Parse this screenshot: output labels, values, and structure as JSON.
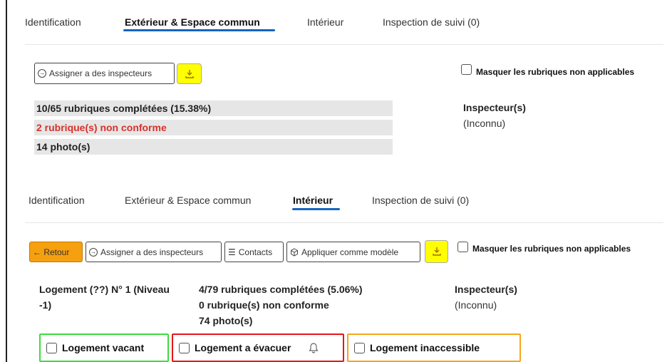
{
  "section1": {
    "tabs": [
      {
        "label": "Identification",
        "active": false
      },
      {
        "label": "Extérieur & Espace commun",
        "active": true
      },
      {
        "label": "Intérieur",
        "active": false
      },
      {
        "label": "Inspection de suivi (0)",
        "active": false
      }
    ],
    "assign_button": "Assigner a des inspecteurs",
    "download_icon": "download-icon",
    "hide_checkbox_label": "Masquer les rubriques non applicables",
    "stats": {
      "completed": "10/65 rubriques complétées (15.38%)",
      "non_conform": "2 rubrique(s) non conforme",
      "photos": "14 photo(s)"
    },
    "inspector_heading": "Inspecteur(s)",
    "inspector_value": "(Inconnu)"
  },
  "section2": {
    "tabs": [
      {
        "label": "Identification",
        "active": false
      },
      {
        "label": "Extérieur & Espace commun",
        "active": false
      },
      {
        "label": "Intérieur",
        "active": true
      },
      {
        "label": "Inspection de suivi (0)",
        "active": false
      }
    ],
    "back_button": "← Retour",
    "assign_button": "Assigner a des inspecteurs",
    "contacts_button": "Contacts",
    "apply_model_button": "Appliquer comme modèle",
    "download_icon": "download-icon",
    "hide_checkbox_label": "Masquer les rubriques non applicables",
    "unit_title_line1": "Logement (??) N° 1 (Niveau",
    "unit_title_line2": "-1)",
    "stats": {
      "completed": "4/79 rubriques complétées (5.06%)",
      "non_conform": "0 rubrique(s) non conforme",
      "photos": "74 photo(s)"
    },
    "inspector_heading": "Inspecteur(s)",
    "inspector_value": "(Inconnu)",
    "status_boxes": [
      {
        "label": "Logement vacant",
        "color": "#3ddc3d"
      },
      {
        "label": "Logement a évacuer",
        "color": "#e8141b",
        "icon": "bell-icon"
      },
      {
        "label": "Logement inaccessible",
        "color": "#f7a51b"
      }
    ]
  },
  "colors": {
    "accent": "#1565c0",
    "highlight": "#ffff00",
    "back_button": "#f5a00f",
    "danger": "#d9302a"
  }
}
